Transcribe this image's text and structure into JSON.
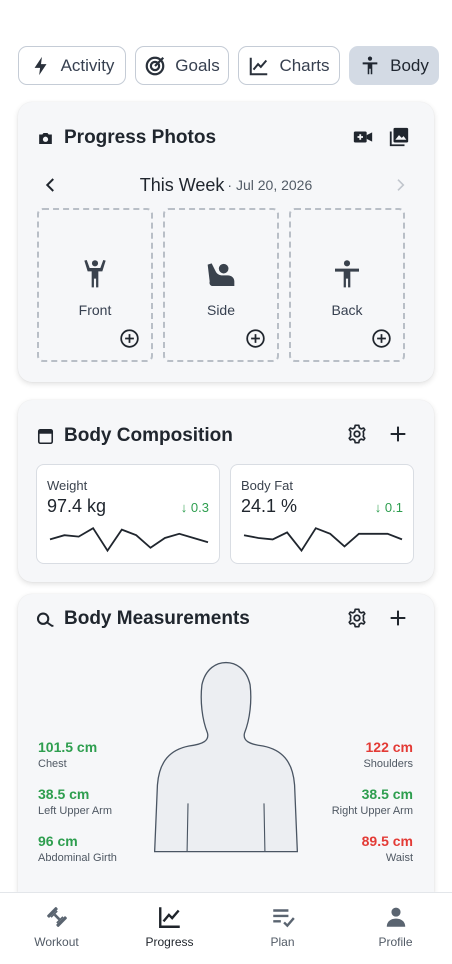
{
  "tabs": [
    {
      "label": "Activity",
      "icon": "bolt-icon",
      "active": false
    },
    {
      "label": "Goals",
      "icon": "target-icon",
      "active": false
    },
    {
      "label": "Charts",
      "icon": "line-chart-icon",
      "active": false
    },
    {
      "label": "Body",
      "icon": "body-icon",
      "active": true
    }
  ],
  "progress_photos": {
    "title": "Progress Photos",
    "week_label": "This Week",
    "week_date": "· Jul 20, 2026",
    "slots": [
      {
        "label": "Front"
      },
      {
        "label": "Side"
      },
      {
        "label": "Back"
      }
    ]
  },
  "body_composition": {
    "title": "Body Composition",
    "metrics": [
      {
        "name": "Weight",
        "value": "97.4 kg",
        "delta": "0.3",
        "trend": [
          0.55,
          0.4,
          0.45,
          0.15,
          0.95,
          0.2,
          0.4,
          0.85,
          0.5,
          0.35,
          0.5,
          0.65
        ]
      },
      {
        "name": "Body Fat",
        "value": "24.1 %",
        "delta": "0.1",
        "trend": [
          0.4,
          0.5,
          0.55,
          0.3,
          0.95,
          0.15,
          0.35,
          0.8,
          0.35,
          0.35,
          0.35,
          0.55
        ]
      }
    ]
  },
  "body_measurements": {
    "title": "Body Measurements",
    "left": [
      {
        "value": "101.5 cm",
        "label": "Chest",
        "status": "good"
      },
      {
        "value": "38.5 cm",
        "label": "Left Upper Arm",
        "status": "good"
      },
      {
        "value": "96 cm",
        "label": "Abdominal Girth",
        "status": "good"
      }
    ],
    "right": [
      {
        "value": "122 cm",
        "label": "Shoulders",
        "status": "bad"
      },
      {
        "value": "38.5 cm",
        "label": "Right Upper Arm",
        "status": "good"
      },
      {
        "value": "89.5 cm",
        "label": "Waist",
        "status": "bad"
      }
    ]
  },
  "bottom_nav": [
    {
      "label": "Workout",
      "icon": "dumbbell-icon",
      "active": false
    },
    {
      "label": "Progress",
      "icon": "line-chart-icon",
      "active": true
    },
    {
      "label": "Plan",
      "icon": "checklist-icon",
      "active": false
    },
    {
      "label": "Profile",
      "icon": "person-icon",
      "active": false
    }
  ],
  "colors": {
    "good": "#2e9e4f",
    "bad": "#e33b36",
    "active_chip": "#d3dae4"
  }
}
